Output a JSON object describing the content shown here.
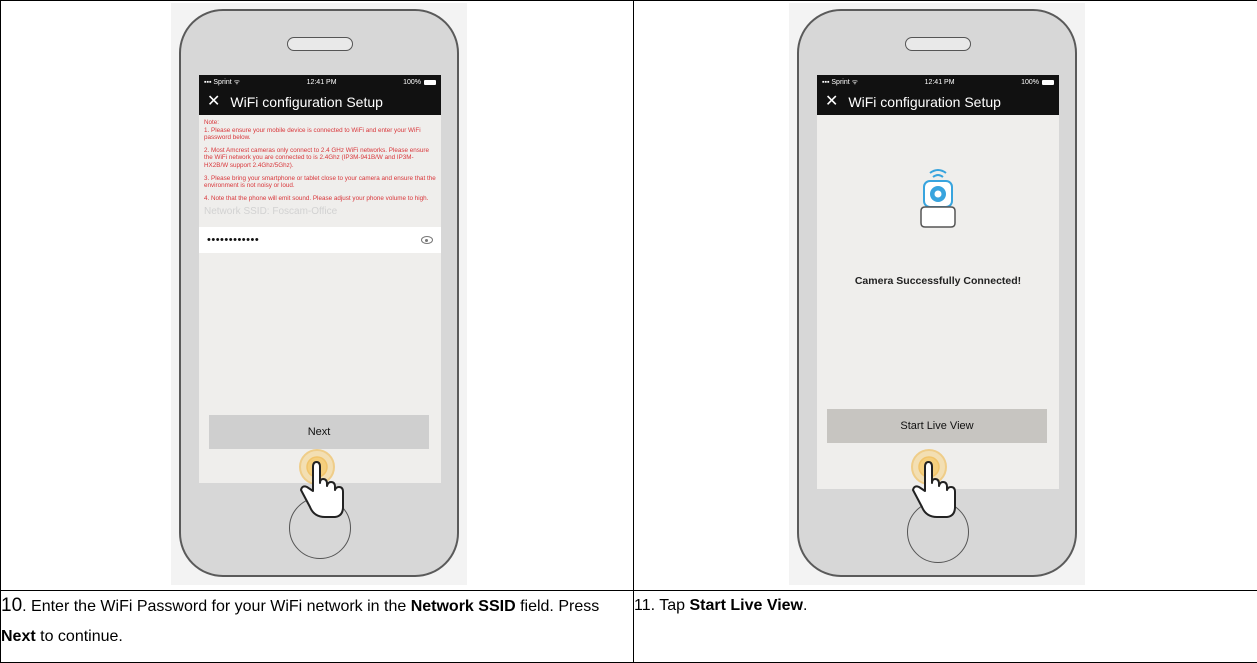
{
  "left_step": {
    "status": {
      "carrier": "Sprint",
      "time": "12:41 PM",
      "battery": "100%"
    },
    "nav_title": "WiFi configuration Setup",
    "notes": [
      "Note:",
      "1. Please ensure your mobile device is connected to WiFi and enter your WiFi password below.",
      "2. Most Amcrest cameras only connect to 2.4 GHz WiFi networks. Please ensure the WiFi network you are connected to is 2.4Ghz (IP3M-941B/W and IP3M-HX2B/W support 2.4Ghz/5Ghz).",
      "3. Please bring your smartphone or tablet close to your camera and ensure that the environment is not noisy or loud.",
      "4. Note that the phone will emit sound. Please adjust your phone volume to high."
    ],
    "ssid_label": "Network SSID: Foscam-Office",
    "password_value": "••••••••••••",
    "next_label": "Next",
    "caption": {
      "num": "10",
      "t1": ". Enter the WiFi Password for your WiFi network in the ",
      "b1": "Network SSID",
      "t2": " field. Press ",
      "b2": "Next",
      "t3": " to continue."
    }
  },
  "right_step": {
    "status": {
      "carrier": "Sprint",
      "time": "12:41 PM",
      "battery": "100%"
    },
    "nav_title": "WiFi configuration Setup",
    "success_message": "Camera Successfully Connected!",
    "live_label": "Start Live View",
    "caption": {
      "t1": "11. Tap ",
      "b1": "Start Live View",
      "t2": "."
    }
  },
  "colors": {
    "note_red": "#d9363a",
    "nav_black": "#111111",
    "tap_ring": "#f0b33a",
    "camera_blue": "#38a4de"
  },
  "icons": [
    "close-icon",
    "eye-icon",
    "camera-icon",
    "pointing-hand-icon",
    "wifi-icon",
    "battery-icon"
  ]
}
